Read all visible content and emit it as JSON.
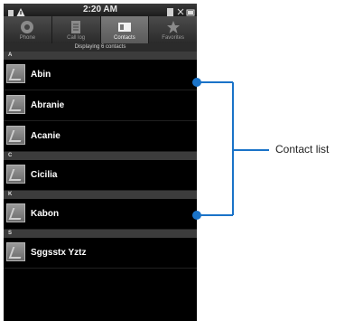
{
  "status_bar": {
    "time": "2:20 AM"
  },
  "tabs": [
    {
      "label": "Phone",
      "icon": "phone-icon",
      "active": false
    },
    {
      "label": "Call log",
      "icon": "call-log-icon",
      "active": false
    },
    {
      "label": "Contacts",
      "icon": "contacts-icon",
      "active": true
    },
    {
      "label": "Favorites",
      "icon": "star-icon",
      "active": false
    }
  ],
  "display_text": "Displaying 6 contacts",
  "sections": [
    {
      "letter": "A",
      "contacts": [
        "Abin",
        "Abranie",
        "Acanie"
      ]
    },
    {
      "letter": "C",
      "contacts": [
        "Cicilia"
      ]
    },
    {
      "letter": "K",
      "contacts": [
        "Kabon"
      ]
    },
    {
      "letter": "S",
      "contacts": [
        "Sggsstx Yztz"
      ]
    }
  ],
  "annotation": {
    "label": "Contact list",
    "color": "#1a73c8"
  }
}
